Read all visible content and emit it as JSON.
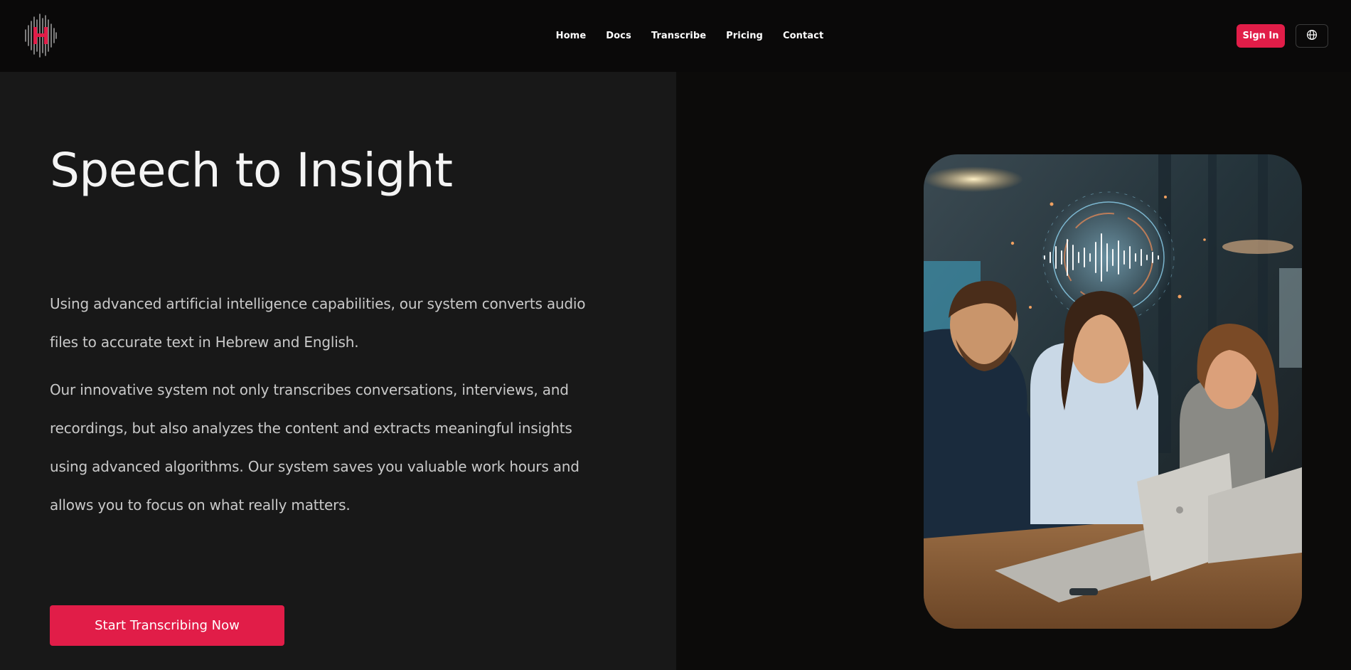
{
  "header": {
    "logo_icon": "soundwave-h-logo",
    "nav": [
      {
        "label": "Home"
      },
      {
        "label": "Docs"
      },
      {
        "label": "Transcribe"
      },
      {
        "label": "Pricing"
      },
      {
        "label": "Contact"
      }
    ],
    "signin_label": "Sign In",
    "language_icon": "globe-icon"
  },
  "hero": {
    "title": "Speech to Insight",
    "paragraph_1": "Using advanced artificial intelligence capabilities, our system converts audio files to accurate text in Hebrew and English.",
    "paragraph_2": "Our innovative system not only transcribes conversations, interviews, and recordings, but also analyzes the content and extracts meaningful insights using advanced algorithms. Our system saves you valuable work hours and allows you to focus on what really matters.",
    "cta_label": "Start Transcribing Now",
    "image_icon": "team-laptop-soundwave-photo"
  },
  "colors": {
    "accent": "#e11d48",
    "header_bg": "#0a0909",
    "left_panel_bg": "#181818",
    "right_panel_bg": "#0c0b0a",
    "body_text": "#c9c9c9"
  }
}
